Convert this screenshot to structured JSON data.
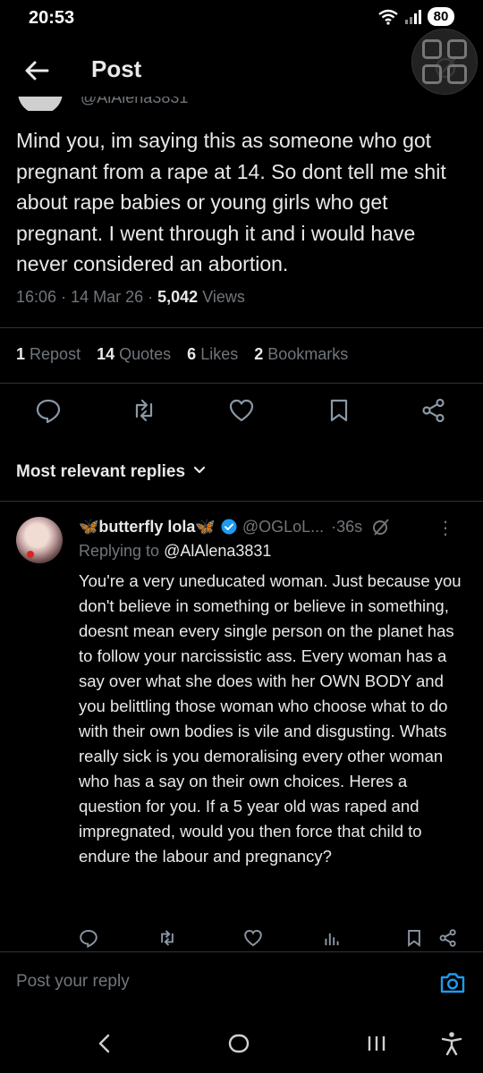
{
  "status_bar": {
    "time": "20:53",
    "battery": "80"
  },
  "header": {
    "title": "Post"
  },
  "tweet": {
    "author_handle_partial": "@AlAlena3831",
    "text": "Mind you, im saying this as someone who got pregnant from a rape at 14. So dont tell me shit about rape babies or young girls who get pregnant. I went through it and i would have never considered an abortion.",
    "time": "16:06",
    "date": "14 Mar 26",
    "views_count": "5,042",
    "views_label": "Views",
    "stats": {
      "reposts": "1",
      "reposts_label": "Repost",
      "quotes": "14",
      "quotes_label": "Quotes",
      "likes": "6",
      "likes_label": "Likes",
      "bookmarks": "2",
      "bookmarks_label": "Bookmarks"
    }
  },
  "replies_filter": {
    "label": "Most relevant replies"
  },
  "reply": {
    "name": "🦋butterfly lola🦋",
    "handle": "@OGLoL...",
    "time": "36s",
    "replying_prefix": "Replying to",
    "replying_to": "@AlAlena3831",
    "text": "You're a very uneducated woman. Just because you don't believe in something or believe in something, doesnt mean every single person on the planet has to follow your narcissistic ass. Every woman has a say over what she does with her OWN BODY and you belittling those woman who choose what to do with their own bodies is vile and disgusting. Whats really sick is you demoralising every other woman who has a say on their own choices. Heres a question for you. If a 5 year old was raped and impregnated, would you then force that child to endure the labour and pregnancy?"
  },
  "compose": {
    "placeholder": "Post your reply"
  },
  "colors": {
    "background": "#000000",
    "text": "#e7e9ea",
    "secondary": "#71767b",
    "accent": "#1d9bf0",
    "divider": "#2f3336"
  },
  "icons": [
    "back-arrow-icon",
    "grok-icon",
    "reply-icon",
    "repost-icon",
    "like-icon",
    "bookmark-icon",
    "share-icon",
    "chevron-down-icon",
    "verified-icon",
    "more-icon",
    "views-icon",
    "camera-icon",
    "nav-back-icon",
    "nav-home-icon",
    "nav-recents-icon",
    "accessibility-icon"
  ]
}
